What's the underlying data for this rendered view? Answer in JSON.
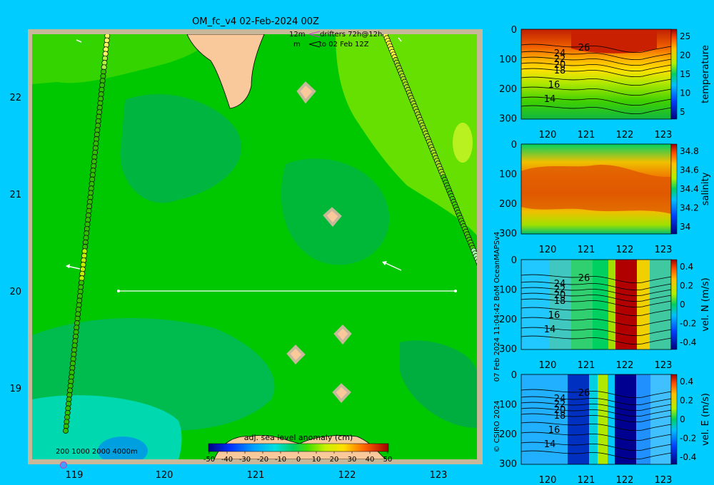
{
  "map": {
    "title": "OM_fc_v4  02-Feb-2024 00Z",
    "legend_12m": "12m",
    "legend_m": "m",
    "legend_drifters": "drifters 72h@12h",
    "legend_to": "to 02 Feb 12Z",
    "lat_ticks": [
      "22",
      "21",
      "20",
      "19"
    ],
    "lon_ticks": [
      "119",
      "120",
      "121",
      "122",
      "123"
    ],
    "bathy_legend": "200  1000  2000  4000m",
    "colorbar_title": "adj. sea level anomaly (cm)",
    "colorbar_ticks": [
      "-50",
      "-40",
      "-30",
      "-20",
      "-10",
      "0",
      "10",
      "20",
      "30",
      "40",
      "50"
    ]
  },
  "side_text": "07 Feb 2024 11:04:42 BoM OceanMAPSv4",
  "copyright": "© CSIRO 2024",
  "sections": [
    {
      "name": "temperature",
      "cbar_ticks": [
        "25",
        "20",
        "15",
        "10",
        "5"
      ],
      "contour_labels": [
        "26",
        "24",
        "22",
        "20",
        "18",
        "16",
        "14"
      ]
    },
    {
      "name": "salinity",
      "cbar_ticks": [
        "34.8",
        "34.6",
        "34.4",
        "34.2",
        "34"
      ],
      "contour_labels": []
    },
    {
      "name": "vel. N (m/s)",
      "cbar_ticks": [
        "0.4",
        "0.2",
        "0",
        "-0.2",
        "-0.4"
      ],
      "contour_labels": [
        "26",
        "24",
        "22",
        "20",
        "18",
        "16",
        "14"
      ]
    },
    {
      "name": "vel. E (m/s)",
      "cbar_ticks": [
        "0.4",
        "0.2",
        "0",
        "-0.2",
        "-0.4"
      ],
      "contour_labels": [
        "26",
        "24",
        "22",
        "20",
        "18",
        "16",
        "14"
      ]
    }
  ],
  "section_axes": {
    "x_ticks": [
      "120",
      "121",
      "122",
      "123"
    ],
    "y_ticks": [
      "0",
      "100",
      "200",
      "300"
    ]
  },
  "colors": {
    "background": "#00ccff",
    "land": "#f9c89b",
    "shelf": "#c8b89a",
    "ocean_base": "#00c800",
    "ocean_light": "#66e000",
    "ocean_dark": "#00b050",
    "ocean_cyan": "#00d8b0"
  }
}
